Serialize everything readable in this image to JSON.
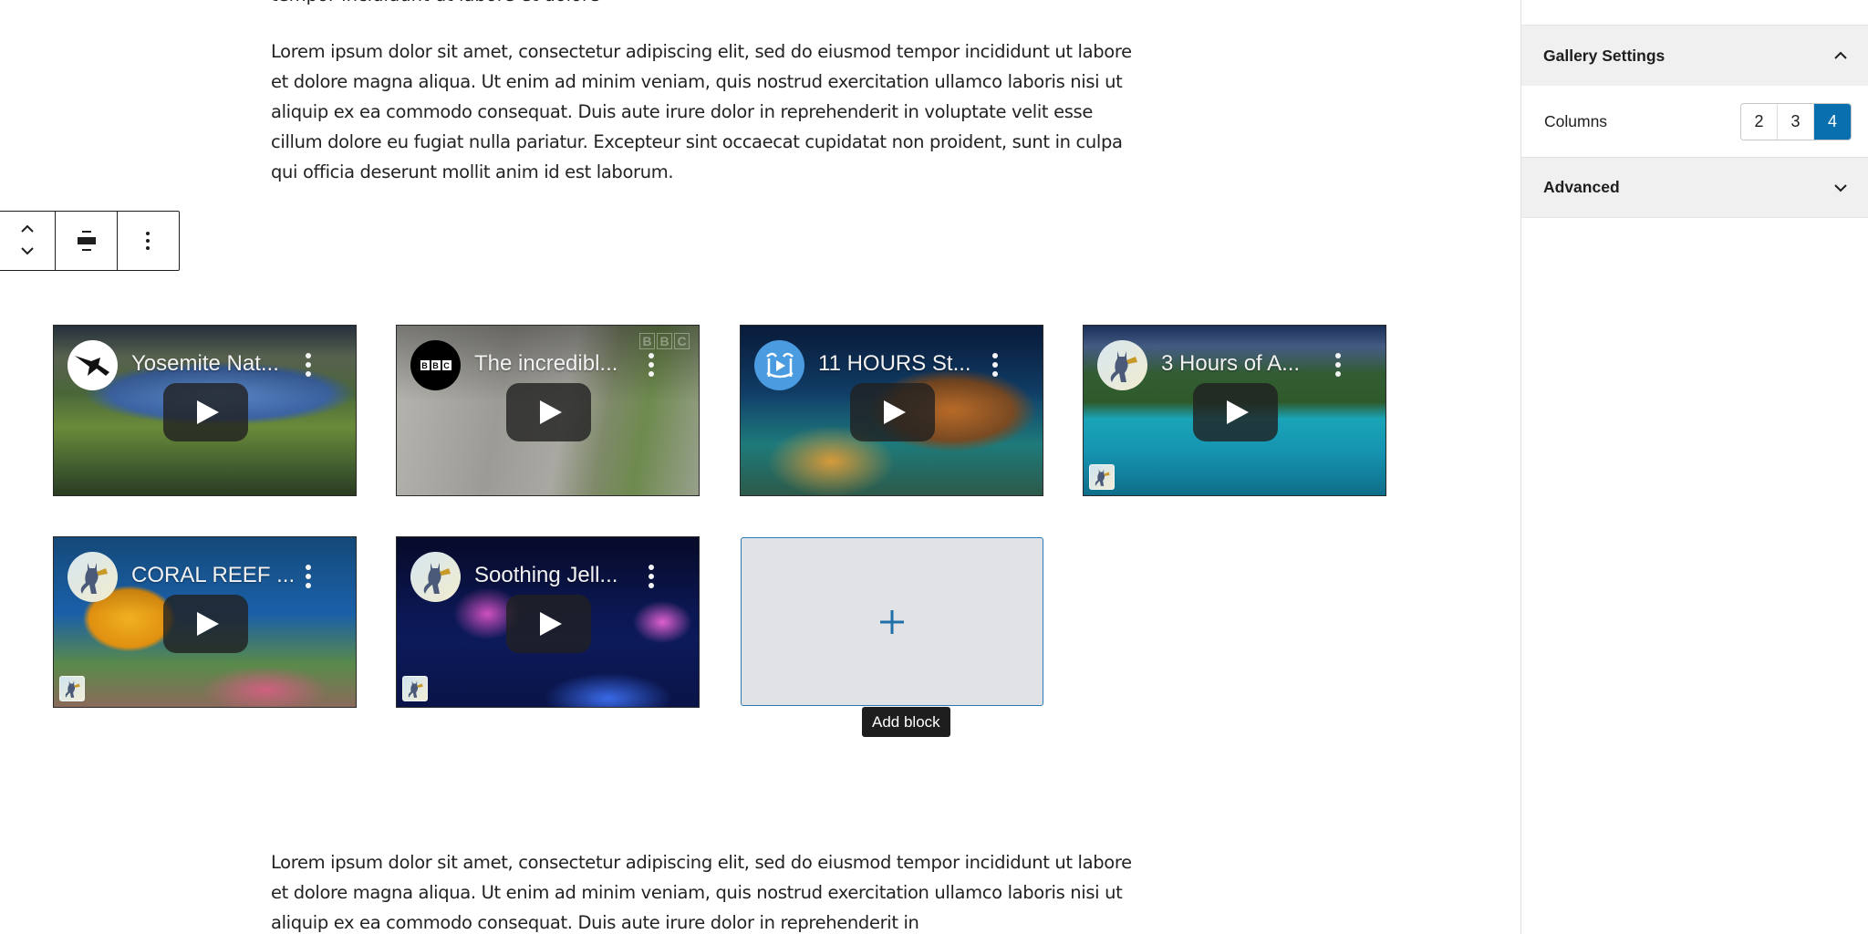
{
  "editor": {
    "paragraph_top_clipped": "tempor incididunt ut labore et dolore magna aliqua",
    "paragraph_top": "Lorem ipsum dolor sit amet, consectetur adipiscing elit, sed do eiusmod tempor incididunt ut labore et dolore magna aliqua. Ut enim ad minim veniam, quis nostrud exercitation ullamco laboris nisi ut aliquip ex ea commodo consequat. Duis aute irure dolor in reprehenderit in voluptate velit esse cillum dolore eu fugiat nulla pariatur. Excepteur sint occaecat cupidatat non proident, sunt in culpa qui officia deserunt mollit anim id est laborum.",
    "paragraph_bottom": "Lorem ipsum dolor sit amet, consectetur adipiscing elit, sed do eiusmod tempor incididunt ut labore et dolore magna aliqua. Ut enim ad minim veniam, quis nostrud exercitation ullamco laboris nisi ut aliquip ex ea commodo consequat. Duis aute irure dolor in reprehenderit in",
    "block_toolbar": {
      "move_up_icon": "chevron-up-icon",
      "move_down_icon": "chevron-down-icon",
      "align_icon": "align-center-icon",
      "more_icon": "more-vertical-icon"
    },
    "gallery": {
      "videos": [
        {
          "title": "Yosemite Nat...",
          "channel_avatar": "bird-silhouette",
          "has_badge": false
        },
        {
          "title": "The incredibl...",
          "channel_avatar": "BBC",
          "watermark": "BBC",
          "has_badge": false
        },
        {
          "title": "11 HOURS St...",
          "channel_avatar": "palm-tree-play",
          "has_badge": false
        },
        {
          "title": "3 Hours of A...",
          "channel_avatar": "cat-trumpet",
          "has_badge": true
        },
        {
          "title": "CORAL REEF ...",
          "channel_avatar": "cat-trumpet",
          "has_badge": true
        },
        {
          "title": "Soothing Jell...",
          "channel_avatar": "cat-trumpet",
          "has_badge": true
        }
      ],
      "add_block_icon": "plus-icon",
      "add_block_tooltip": "Add block"
    }
  },
  "sidebar": {
    "gallery_settings": {
      "title": "Gallery Settings",
      "expanded": true,
      "columns_label": "Columns",
      "column_options": [
        "2",
        "3",
        "4"
      ],
      "selected_columns": "4"
    },
    "advanced": {
      "title": "Advanced",
      "expanded": false
    }
  },
  "colors": {
    "accent": "#0a6fae",
    "add_block_border": "#2c7ab4",
    "add_block_fill": "#e0e2e6",
    "panel_header_bg": "#f0f0f1",
    "tooltip_bg": "#1e1e1e"
  }
}
